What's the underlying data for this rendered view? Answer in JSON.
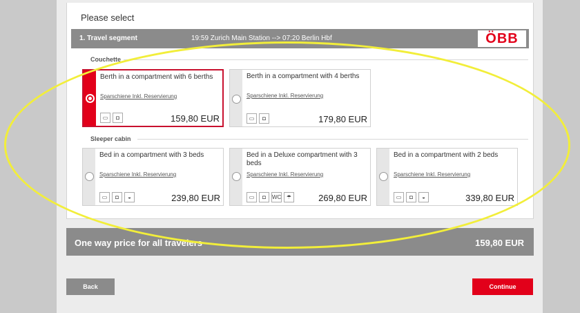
{
  "heading": "Please select",
  "segment": {
    "label": "1. Travel segment",
    "route": "19:59 Zurich Main Station --> 07:20 Berlin Hbf",
    "logo": "ÖBB"
  },
  "sections": [
    {
      "title": "Couchette",
      "options": [
        {
          "title": "Berth in a compartment with 6 berths",
          "tariff": "Sparschiene Inkl. Reservierung",
          "price": "159,80 EUR",
          "selected": true,
          "icons": [
            "bed-icon",
            "luggage-icon"
          ]
        },
        {
          "title": "Berth in a compartment with 4 berths",
          "tariff": "Sparschiene Inkl. Reservierung",
          "price": "179,80 EUR",
          "selected": false,
          "icons": [
            "bed-icon",
            "luggage-icon"
          ]
        }
      ]
    },
    {
      "title": "Sleeper cabin",
      "options": [
        {
          "title": "Bed in a compartment with 3 beds",
          "tariff": "Sparschiene Inkl. Reservierung",
          "price": "239,80 EUR",
          "selected": false,
          "icons": [
            "bed-icon",
            "luggage-icon",
            "washbasin-icon"
          ]
        },
        {
          "title": "Bed in a Deluxe compartment with 3 beds",
          "tariff": "Sparschiene Inkl. Reservierung",
          "price": "269,80 EUR",
          "selected": false,
          "icons": [
            "bed-icon",
            "luggage-icon",
            "wc-icon",
            "shower-icon"
          ]
        },
        {
          "title": "Bed in a compartment with 2 beds",
          "tariff": "Sparschiene Inkl. Reservierung",
          "price": "339,80 EUR",
          "selected": false,
          "icons": [
            "bed-icon",
            "luggage-icon",
            "washbasin-icon"
          ]
        }
      ]
    }
  ],
  "total": {
    "label": "One way price for all travelers",
    "amount": "159,80 EUR"
  },
  "buttons": {
    "back": "Back",
    "continue": "Continue"
  },
  "colors": {
    "accent": "#e2001a",
    "bar": "#8b8b8b",
    "highlight": "#f2ee3a"
  }
}
